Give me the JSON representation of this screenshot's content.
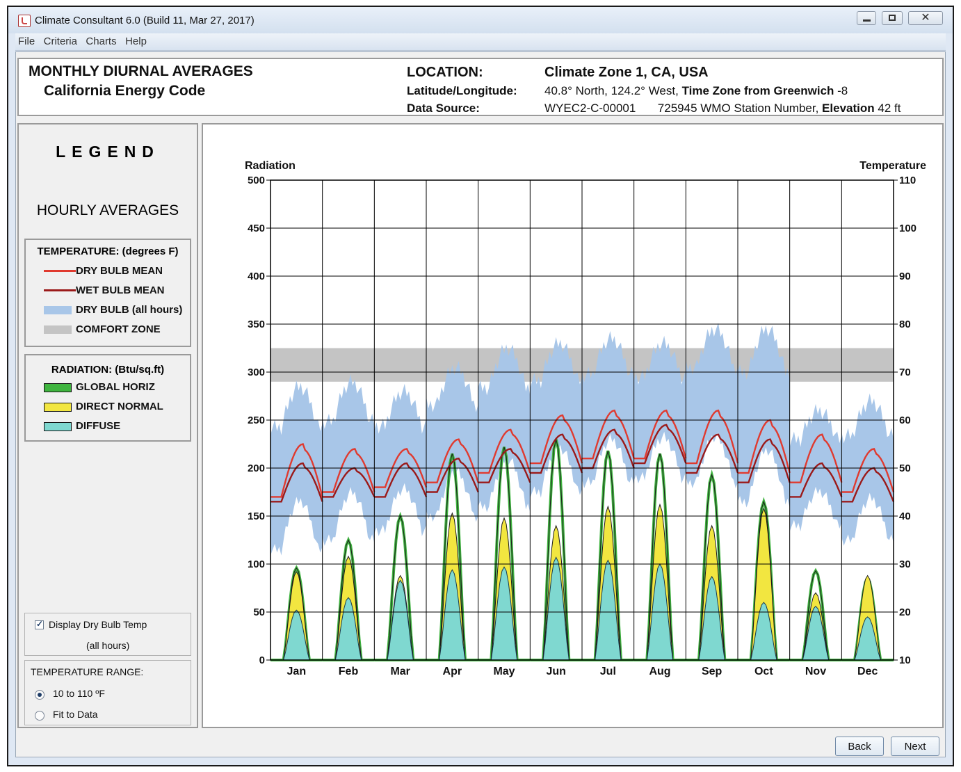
{
  "window": {
    "title": "Climate Consultant 6.0 (Build 11, Mar 27, 2017)",
    "controls": [
      "minimize-icon",
      "restore-icon",
      "close-icon"
    ]
  },
  "menu": [
    "File",
    "Criteria",
    "Charts",
    "Help"
  ],
  "header": {
    "title": "MONTHLY DIURNAL AVERAGES",
    "subtitle": "California Energy Code",
    "location_label": "LOCATION:",
    "location_value": "Climate Zone 1, CA, USA",
    "latlon_label": "Latitude/Longitude:",
    "latlon_value": "40.8° North, 124.2° West,",
    "timezone_label": "Time Zone from Greenwich",
    "timezone_value": "-8",
    "source_label": "Data Source:",
    "source_value": "WYEC2-C-00001",
    "station_value": "725945 WMO Station Number,",
    "elevation_label": "Elevation",
    "elevation_value": "42 ft"
  },
  "legend": {
    "title": "LEGEND",
    "hourly_title": "HOURLY AVERAGES",
    "temperature_title": "TEMPERATURE: (degrees F)",
    "temperature_items": [
      {
        "label": "DRY BULB MEAN",
        "color": "#e03a2f"
      },
      {
        "label": "WET BULB MEAN",
        "color": "#9b1a1a"
      },
      {
        "label": "DRY BULB (all hours)",
        "color": "#a8c6e8"
      },
      {
        "label": "COMFORT ZONE",
        "color": "#c4c4c4"
      }
    ],
    "radiation_title": "RADIATION: (Btu/sq.ft)",
    "radiation_items": [
      {
        "label": "GLOBAL HORIZ",
        "color": "#3fb43f"
      },
      {
        "label": "DIRECT NORMAL",
        "color": "#f2e640"
      },
      {
        "label": "DIFFUSE",
        "color": "#7fd8d0"
      }
    ]
  },
  "controls": {
    "display_label": "Display Dry Bulb Temp",
    "display_sub": "(all hours)",
    "display_checked": true,
    "range_title": "TEMPERATURE RANGE:",
    "range_option1": "10 to 110 ºF",
    "range_option2": "Fit to Data",
    "range_selected": 1
  },
  "buttons": {
    "back": "Back",
    "next": "Next"
  },
  "chart_data": {
    "type": "area",
    "left_axis_label": "Radiation",
    "right_axis_label": "Temperature",
    "ylim_left": [
      0,
      500
    ],
    "ylim_right": [
      10,
      110
    ],
    "left_ticks": [
      0,
      50,
      100,
      150,
      200,
      250,
      300,
      350,
      400,
      450,
      500
    ],
    "right_ticks": [
      10,
      20,
      30,
      40,
      50,
      60,
      70,
      80,
      90,
      100,
      110
    ],
    "categories": [
      "Jan",
      "Feb",
      "Mar",
      "Apr",
      "May",
      "Jun",
      "Jul",
      "Aug",
      "Sep",
      "Oct",
      "Nov",
      "Dec"
    ],
    "grid": true,
    "comfort_zone_temp": [
      68,
      75
    ],
    "series": [
      {
        "name": "GLOBAL HORIZ",
        "peaks": [
          96,
          125,
          150,
          215,
          222,
          230,
          218,
          215,
          193,
          165,
          93,
          85
        ]
      },
      {
        "name": "DIRECT NORMAL",
        "peaks": [
          92,
          108,
          88,
          153,
          148,
          140,
          160,
          162,
          140,
          158,
          70,
          88
        ]
      },
      {
        "name": "DIFFUSE",
        "peaks": [
          52,
          65,
          83,
          94,
          97,
          107,
          104,
          100,
          87,
          60,
          56,
          45
        ]
      },
      {
        "name": "DRY BULB MEAN",
        "min": [
          44,
          45,
          46,
          47,
          49,
          51,
          52,
          52,
          51,
          49,
          47,
          45
        ],
        "max": [
          55,
          54,
          54,
          56,
          58,
          61,
          62,
          62,
          62,
          60,
          57,
          54
        ]
      },
      {
        "name": "WET BULB MEAN",
        "min": [
          43,
          44,
          44,
          45,
          47,
          49,
          50,
          51,
          49,
          47,
          44,
          43
        ],
        "max": [
          51,
          50,
          51,
          52,
          54,
          57,
          58,
          59,
          57,
          56,
          51,
          50
        ]
      },
      {
        "name": "DRY BULB (all hours)",
        "low": [
          33,
          35,
          37,
          40,
          42,
          45,
          47,
          48,
          47,
          43,
          38,
          35
        ],
        "high": [
          67,
          68,
          66,
          71,
          75,
          76,
          77,
          76,
          79,
          79,
          62,
          64
        ]
      }
    ]
  }
}
